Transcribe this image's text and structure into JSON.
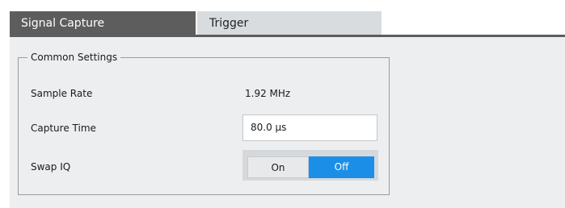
{
  "tabs": [
    {
      "label": "Signal Capture",
      "active": true
    },
    {
      "label": "Trigger",
      "active": false
    }
  ],
  "group": {
    "title": "Common Settings",
    "sample_rate": {
      "label": "Sample Rate",
      "value": "1.92 MHz"
    },
    "capture_time": {
      "label": "Capture Time",
      "value": "80.0 µs"
    },
    "swap_iq": {
      "label": "Swap IQ",
      "options": [
        "On",
        "Off"
      ],
      "selected": "Off"
    }
  },
  "colors": {
    "active_tab": "#5d5d5d",
    "inactive_tab": "#d8dcdf",
    "panel_bg": "#eceef0",
    "selected_toggle": "#1b8fe8"
  }
}
